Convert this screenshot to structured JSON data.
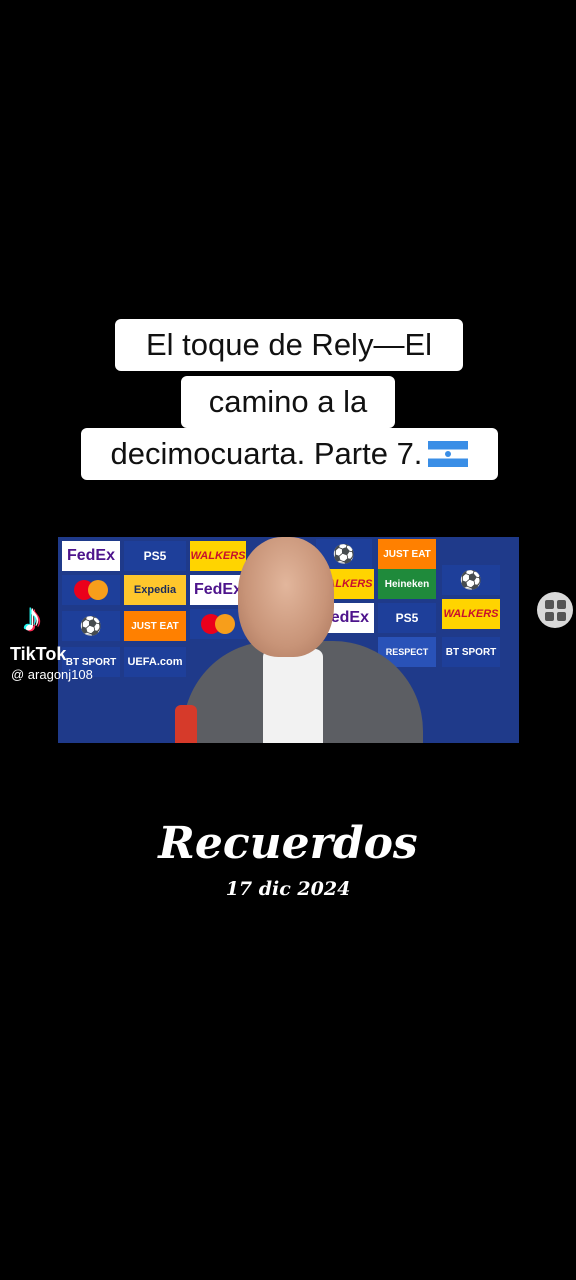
{
  "caption": {
    "line1": "El toque de Rely—El",
    "line2": "camino a la",
    "line3": "decimocuarta. Parte 7."
  },
  "video": {
    "sponsors": {
      "fedex": "FedEx",
      "ps5": "PS5",
      "walkers": "WALKERS",
      "expedia": "Expedia",
      "just_eat": "JUST EAT",
      "heineken": "Heineken",
      "uefa": "UEFA.com",
      "bt_sport": "BT SPORT",
      "respect": "RESPECT"
    }
  },
  "watermark": {
    "brand": "TikTok",
    "username": "@ aragonj108"
  },
  "overlay": {
    "title": "Recuerdos",
    "date": "17 dic 2024"
  },
  "icons": {
    "tiktok": "tiktok-logo-icon",
    "menu": "grid-menu-icon"
  }
}
